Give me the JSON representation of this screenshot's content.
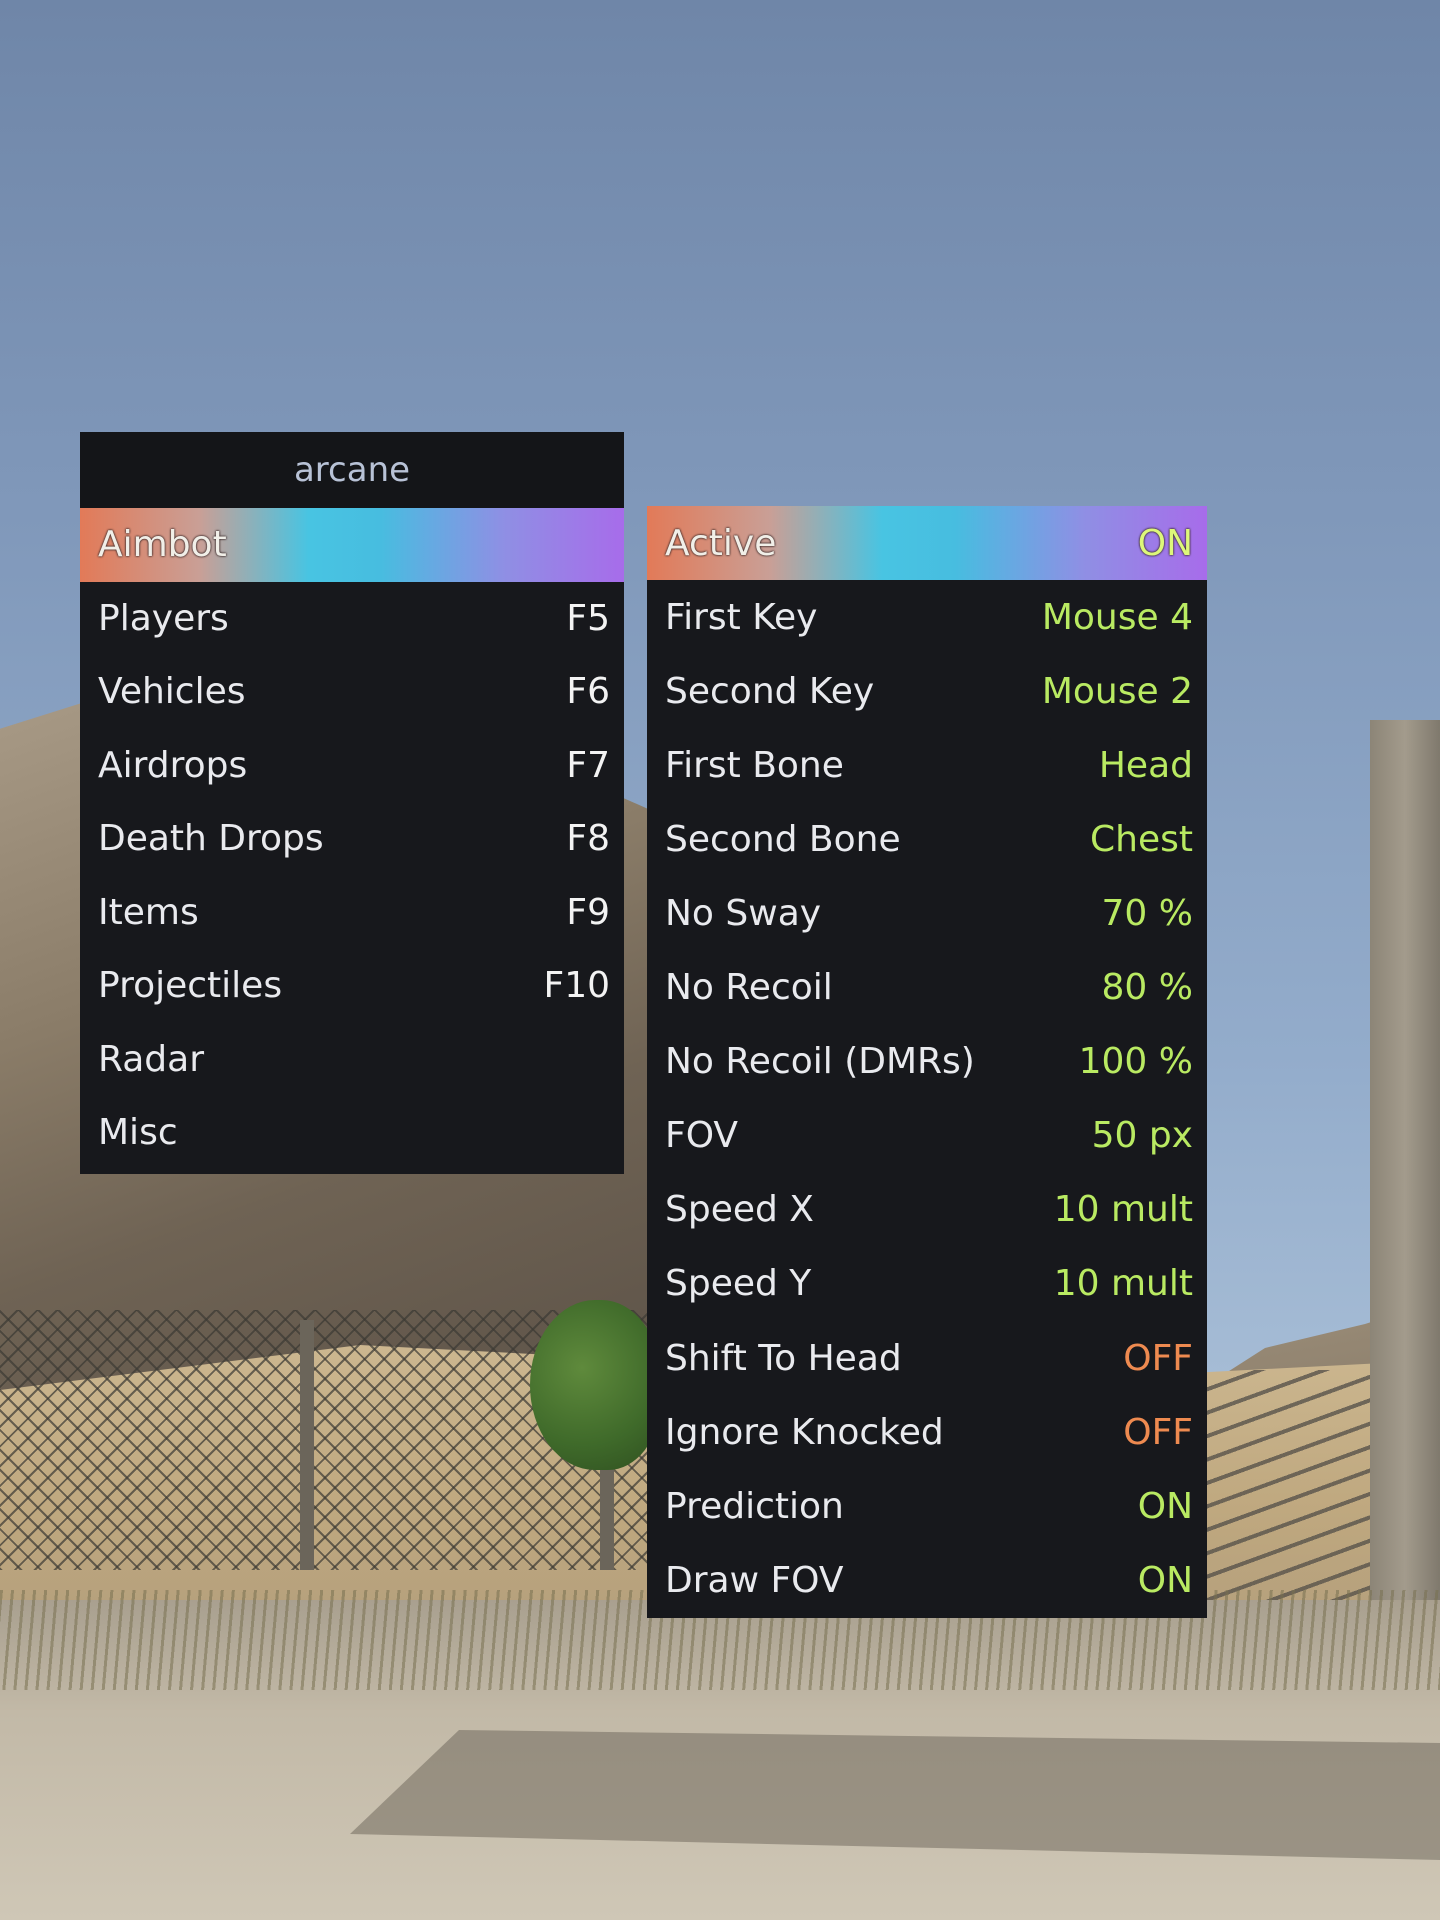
{
  "menu": {
    "title": "arcane",
    "categories": [
      {
        "label": "Aimbot",
        "key": ""
      },
      {
        "label": "Players",
        "key": "F5"
      },
      {
        "label": "Vehicles",
        "key": "F6"
      },
      {
        "label": "Airdrops",
        "key": "F7"
      },
      {
        "label": "Death Drops",
        "key": "F8"
      },
      {
        "label": "Items",
        "key": "F9"
      },
      {
        "label": "Projectiles",
        "key": "F10"
      },
      {
        "label": "Radar",
        "key": ""
      },
      {
        "label": "Misc",
        "key": ""
      }
    ],
    "selected_category": "Aimbot"
  },
  "settings": {
    "rows": [
      {
        "label": "Active",
        "value": "ON",
        "state": "on"
      },
      {
        "label": "First Key",
        "value": "Mouse 4",
        "state": "on"
      },
      {
        "label": "Second Key",
        "value": "Mouse 2",
        "state": "on"
      },
      {
        "label": "First Bone",
        "value": "Head",
        "state": "on"
      },
      {
        "label": "Second Bone",
        "value": "Chest",
        "state": "on"
      },
      {
        "label": "No Sway",
        "value": "70 %",
        "state": "on"
      },
      {
        "label": "No Recoil",
        "value": "80 %",
        "state": "on"
      },
      {
        "label": "No Recoil (DMRs)",
        "value": "100 %",
        "state": "on"
      },
      {
        "label": "FOV",
        "value": "50 px",
        "state": "on"
      },
      {
        "label": "Speed X",
        "value": "10 mult",
        "state": "on"
      },
      {
        "label": "Speed Y",
        "value": "10 mult",
        "state": "on"
      },
      {
        "label": "Shift To Head",
        "value": "OFF",
        "state": "off"
      },
      {
        "label": "Ignore Knocked",
        "value": "OFF",
        "state": "off"
      },
      {
        "label": "Prediction",
        "value": "ON",
        "state": "on"
      },
      {
        "label": "Draw FOV",
        "value": "ON",
        "state": "on"
      }
    ],
    "selected_row": "Active"
  },
  "colors": {
    "panel_bg": "#17181c",
    "value_on": "#b9ea62",
    "value_off": "#ee8a50",
    "highlight_gradient": [
      "#e27a58",
      "#48c4e2",
      "#a76cea"
    ]
  }
}
